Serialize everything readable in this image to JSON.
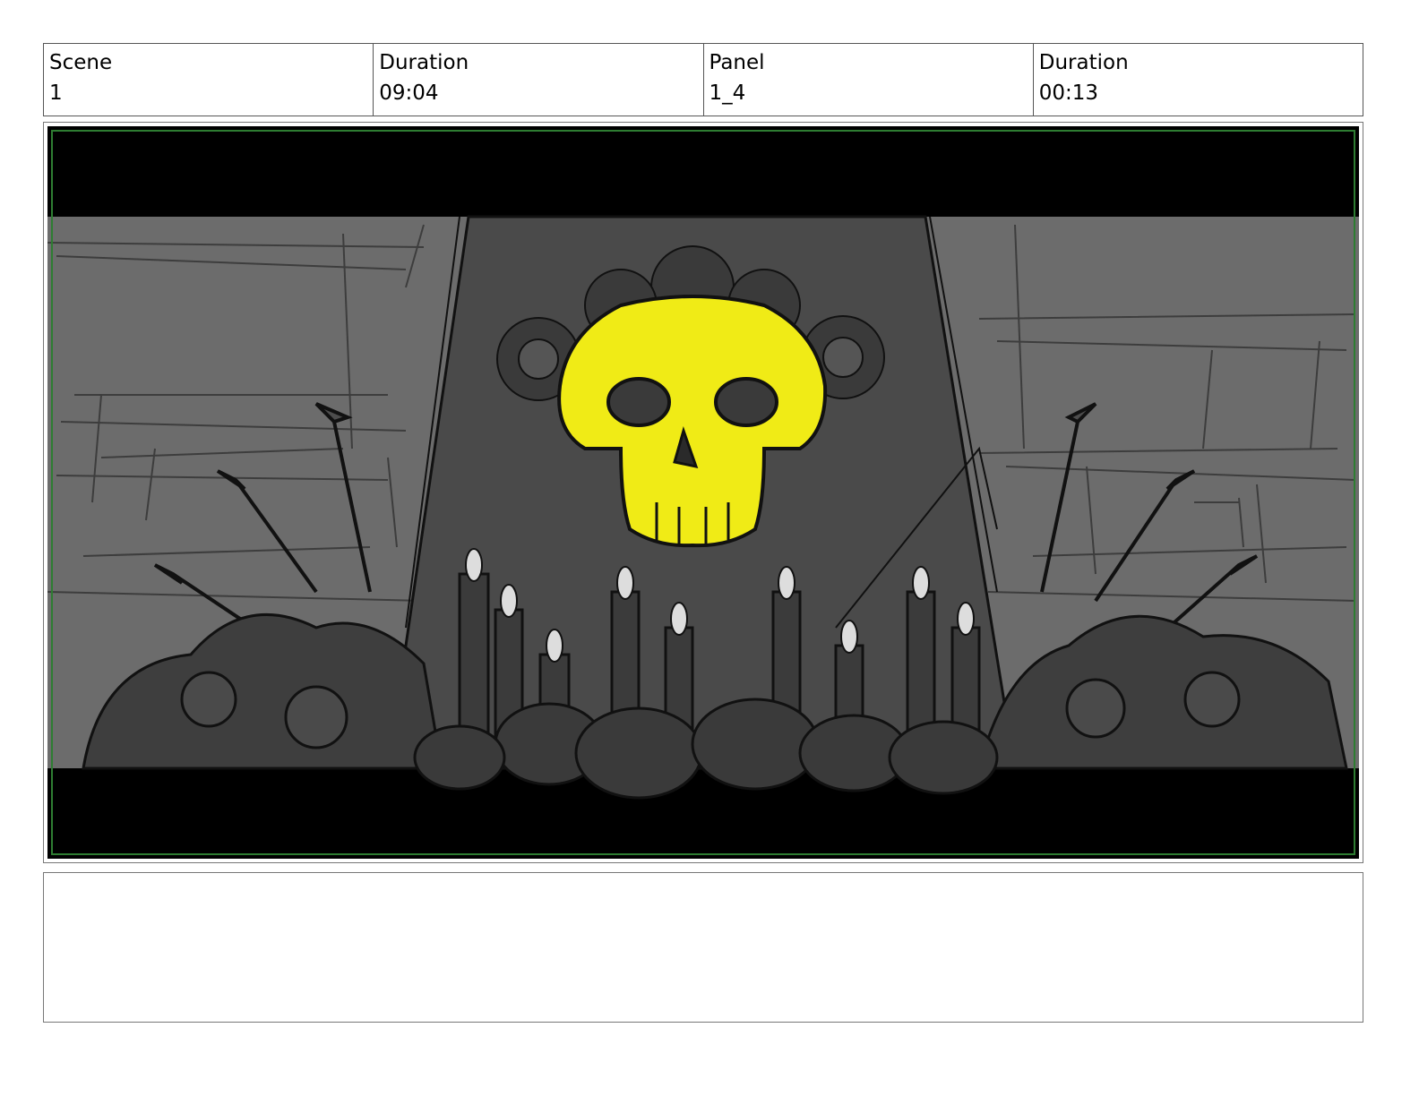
{
  "header": {
    "scene_label": "Scene",
    "scene_value": "1",
    "scene_duration_label": "Duration",
    "scene_duration_value": "09:04",
    "panel_label": "Panel",
    "panel_value": "1_4",
    "panel_duration_label": "Duration",
    "panel_duration_value": "00:13"
  },
  "panel": {
    "icons": [
      "skull-icon",
      "candle-icon",
      "arrow-icon",
      "flower-icon"
    ],
    "colors": {
      "skull": "#f0eb16",
      "background": "#6c6c6c",
      "altar": "#4a4a4a",
      "letterbox": "#000000",
      "safe_frame": "#2e7d32"
    }
  },
  "notes": {
    "text": ""
  }
}
